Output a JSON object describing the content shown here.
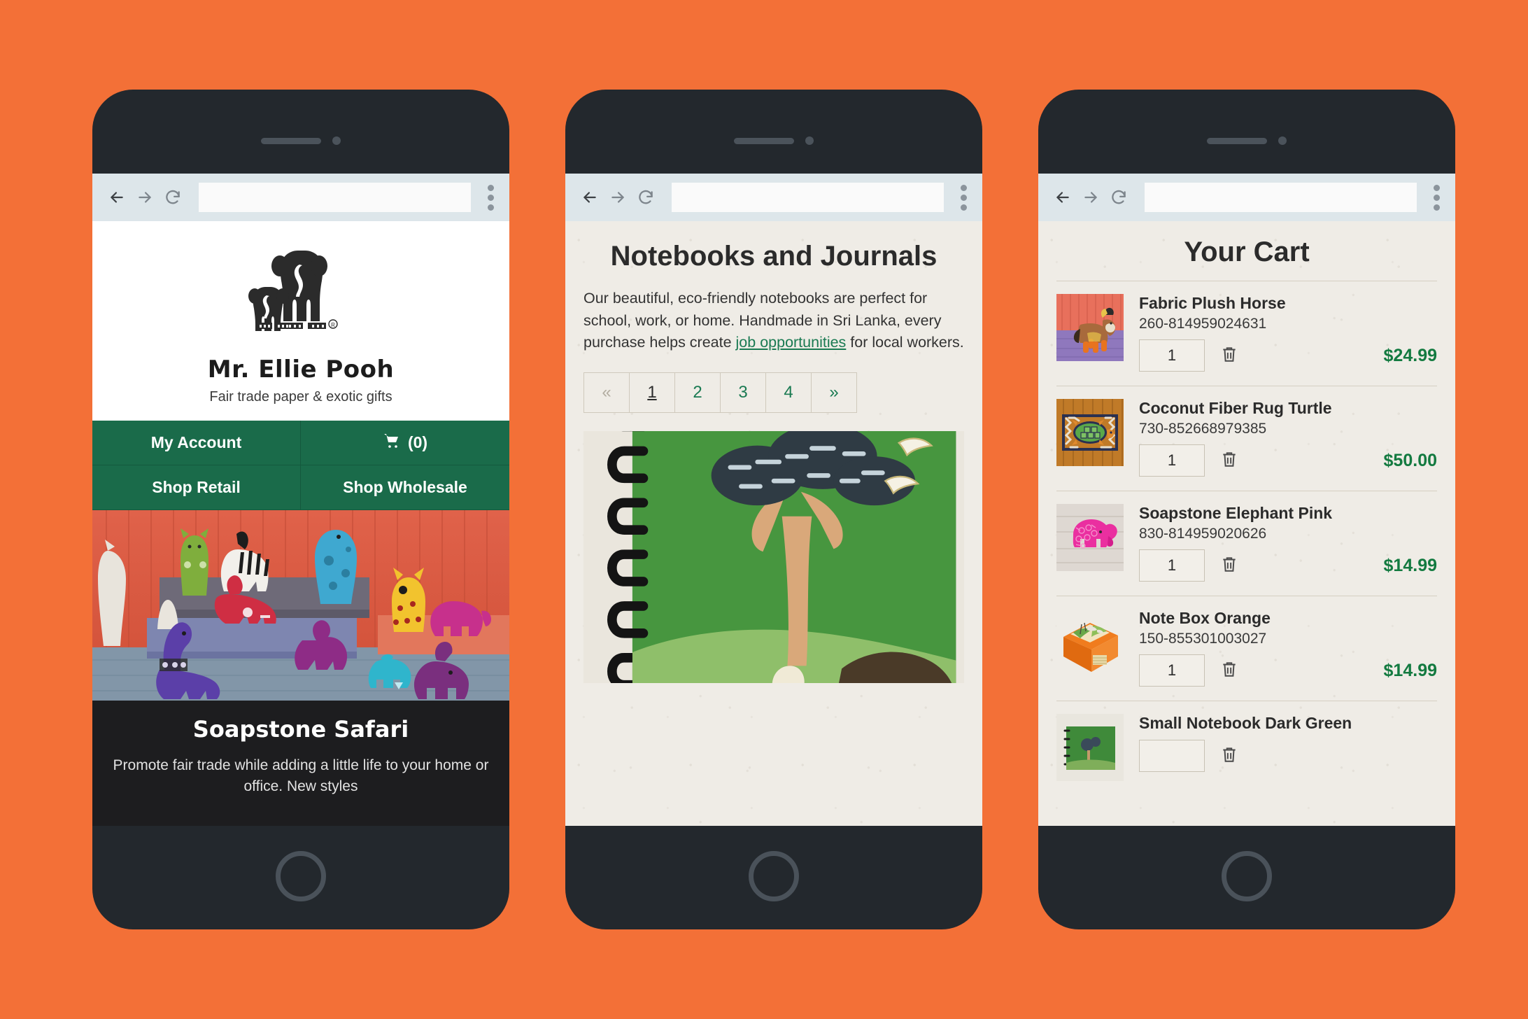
{
  "background_color": "#f37037",
  "browser": {
    "back_icon": "back-arrow-icon",
    "forward_icon": "forward-arrow-icon",
    "reload_icon": "reload-icon",
    "menu_icon": "kebab-menu-icon",
    "url_value": "",
    "url_placeholder": ""
  },
  "phone1": {
    "brand_name": "Mr. Ellie Pooh",
    "tagline": "Fair trade paper & exotic gifts",
    "logo_icon": "elephant-logo-icon",
    "nav": [
      {
        "label": "My Account",
        "icon": null
      },
      {
        "label": "(0)",
        "icon": "cart-icon"
      },
      {
        "label": "Shop Retail",
        "icon": null
      },
      {
        "label": "Shop Wholesale",
        "icon": null
      }
    ],
    "hero_alt": "soapstone-animals-photo",
    "promo_title": "Soapstone Safari",
    "promo_text": "Promote fair trade while adding a little life to your home or office. New styles"
  },
  "phone2": {
    "heading": "Notebooks and Journals",
    "intro_part1": "Our beautiful, eco-friendly notebooks are perfect for school, work, or home. Handmade in Sri Lanka, every purchase helps create ",
    "intro_link": "job opportunities",
    "intro_part2": " for local workers.",
    "pagination": [
      {
        "label": "«",
        "state": "disabled"
      },
      {
        "label": "1",
        "state": "active"
      },
      {
        "label": "2",
        "state": "link"
      },
      {
        "label": "3",
        "state": "link"
      },
      {
        "label": "4",
        "state": "link"
      },
      {
        "label": "»",
        "state": "link"
      }
    ],
    "product_image_alt": "green-elephant-notebook-photo"
  },
  "phone3": {
    "title": "Your Cart",
    "remove_icon": "trash-icon",
    "items": [
      {
        "name": "Fabric Plush Horse",
        "sku": "260-814959024631",
        "qty": "1",
        "price": "$24.99",
        "thumb": "plush-horse-photo"
      },
      {
        "name": "Coconut Fiber Rug Turtle",
        "sku": "730-852668979385",
        "qty": "1",
        "price": "$50.00",
        "thumb": "turtle-rug-photo"
      },
      {
        "name": "Soapstone Elephant Pink",
        "sku": "830-814959020626",
        "qty": "1",
        "price": "$14.99",
        "thumb": "pink-elephant-photo"
      },
      {
        "name": "Note Box Orange",
        "sku": "150-855301003027",
        "qty": "1",
        "price": "$14.99",
        "thumb": "orange-note-box-photo"
      },
      {
        "name": "Small Notebook Dark Green",
        "sku": "",
        "qty": "",
        "price": "",
        "thumb": "green-notebook-photo"
      }
    ]
  },
  "colors": {
    "brand_green": "#1a6b4a",
    "price_green": "#137a40",
    "link_green": "#1a7a52",
    "paper": "#efece6"
  }
}
